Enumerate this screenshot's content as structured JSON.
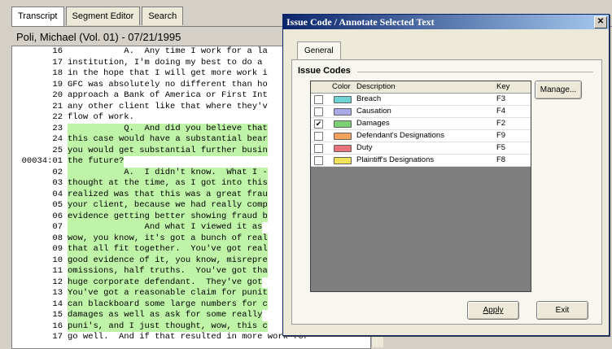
{
  "tabs": [
    "Transcript",
    "Segment Editor",
    "Search"
  ],
  "case_title": "Poli, Michael (Vol. 01) - 07/21/1995",
  "transcript_lines": [
    {
      "num": "16",
      "text": "           A.  Any time I work for a la",
      "hl": false
    },
    {
      "num": "17",
      "text": "institution, I'm doing my best to do a",
      "hl": false
    },
    {
      "num": "18",
      "text": "in the hope that I will get more work i",
      "hl": false
    },
    {
      "num": "19",
      "text": "GFC was absolutely no different than ho",
      "hl": false
    },
    {
      "num": "20",
      "text": "approach a Bank of America or First Int",
      "hl": false
    },
    {
      "num": "21",
      "text": "any other client like that where they'v",
      "hl": false
    },
    {
      "num": "22",
      "text": "flow of work.",
      "hl": false
    },
    {
      "num": "23",
      "text": "           Q.  And did you believe that",
      "hl": true
    },
    {
      "num": "24",
      "text": "this case would have a substantial bear",
      "hl": true
    },
    {
      "num": "25",
      "text": "you would get substantial further busin",
      "hl": true
    },
    {
      "num": "00034:01",
      "text": "the future?",
      "hl": true
    },
    {
      "num": "02",
      "text": "           A.  I didn't know.  What I -",
      "hl": true
    },
    {
      "num": "03",
      "text": "thought at the time, as I got into this",
      "hl": true
    },
    {
      "num": "04",
      "text": "realized was that this was a great frau",
      "hl": true
    },
    {
      "num": "05",
      "text": "your client, because we had really comp",
      "hl": true
    },
    {
      "num": "06",
      "text": "evidence getting better showing fraud b",
      "hl": true
    },
    {
      "num": "07",
      "text": "               And what I viewed it as",
      "hl": true
    },
    {
      "num": "08",
      "text": "wow, you know, it's got a bunch of real",
      "hl": true
    },
    {
      "num": "09",
      "text": "that all fit together.  You've got real",
      "hl": true
    },
    {
      "num": "10",
      "text": "good evidence of it, you know, misrepre",
      "hl": true
    },
    {
      "num": "11",
      "text": "omissions, half truths.  You've got tha",
      "hl": true
    },
    {
      "num": "12",
      "text": "huge corporate defendant.  They've got",
      "hl": true
    },
    {
      "num": "13",
      "text": "You've got a reasonable claim for punit",
      "hl": true
    },
    {
      "num": "14",
      "text": "can blackboard some large numbers for c",
      "hl": true
    },
    {
      "num": "15",
      "text": "damages as well as ask for some really",
      "hl": true
    },
    {
      "num": "16",
      "text": "puni's, and I just thought, wow, this c",
      "hl": true
    },
    {
      "num": "17",
      "text": "go well.  And if that resulted in more work for",
      "hl": false
    }
  ],
  "dialog": {
    "title": "Issue Code / Annotate Selected Text",
    "close_glyph": "✕",
    "tab": "General",
    "section_label": "Issue Codes",
    "columns": {
      "color": "Color",
      "description": "Description",
      "key": "Key"
    },
    "codes": [
      {
        "description": "Breach",
        "key": "F3",
        "color": "#6fd3d3",
        "checked": false
      },
      {
        "description": "Causation",
        "key": "F4",
        "color": "#a9a9e8",
        "checked": false
      },
      {
        "description": "Damages",
        "key": "F2",
        "color": "#7ccf72",
        "checked": true
      },
      {
        "description": "Defendant's Designations",
        "key": "F9",
        "color": "#f2a25a",
        "checked": false
      },
      {
        "description": "Duty",
        "key": "F5",
        "color": "#e8737a",
        "checked": false
      },
      {
        "description": "Plaintiff's Designations",
        "key": "F8",
        "color": "#f0e25a",
        "checked": false
      }
    ],
    "buttons": {
      "manage": "Manage...",
      "apply": "Apply",
      "exit": "Exit"
    }
  }
}
